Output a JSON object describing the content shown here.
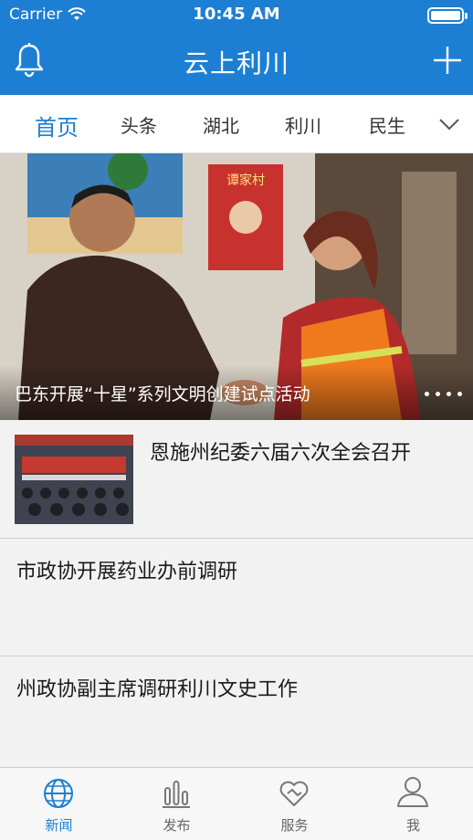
{
  "status": {
    "carrier": "Carrier",
    "time": "10:45 AM"
  },
  "nav": {
    "title": "云上利川"
  },
  "tabs": [
    {
      "label": "首页",
      "active": true
    },
    {
      "label": "头条"
    },
    {
      "label": "湖北"
    },
    {
      "label": "利川"
    },
    {
      "label": "民生"
    }
  ],
  "hero": {
    "caption": "巴东开展“十星”系列文明创建试点活动"
  },
  "news": [
    {
      "title": "恩施州纪委六届六次全会召开",
      "has_thumb": true
    },
    {
      "title": "市政协开展药业办前调研"
    },
    {
      "title": "州政协副主席调研利川文史工作"
    }
  ],
  "tabbar": [
    {
      "label": "新闻",
      "icon": "globe-icon",
      "active": true
    },
    {
      "label": "发布",
      "icon": "bars-icon"
    },
    {
      "label": "服务",
      "icon": "heart-icon"
    },
    {
      "label": "我",
      "icon": "user-icon"
    }
  ],
  "colors": {
    "accent": "#1c7fd3"
  }
}
